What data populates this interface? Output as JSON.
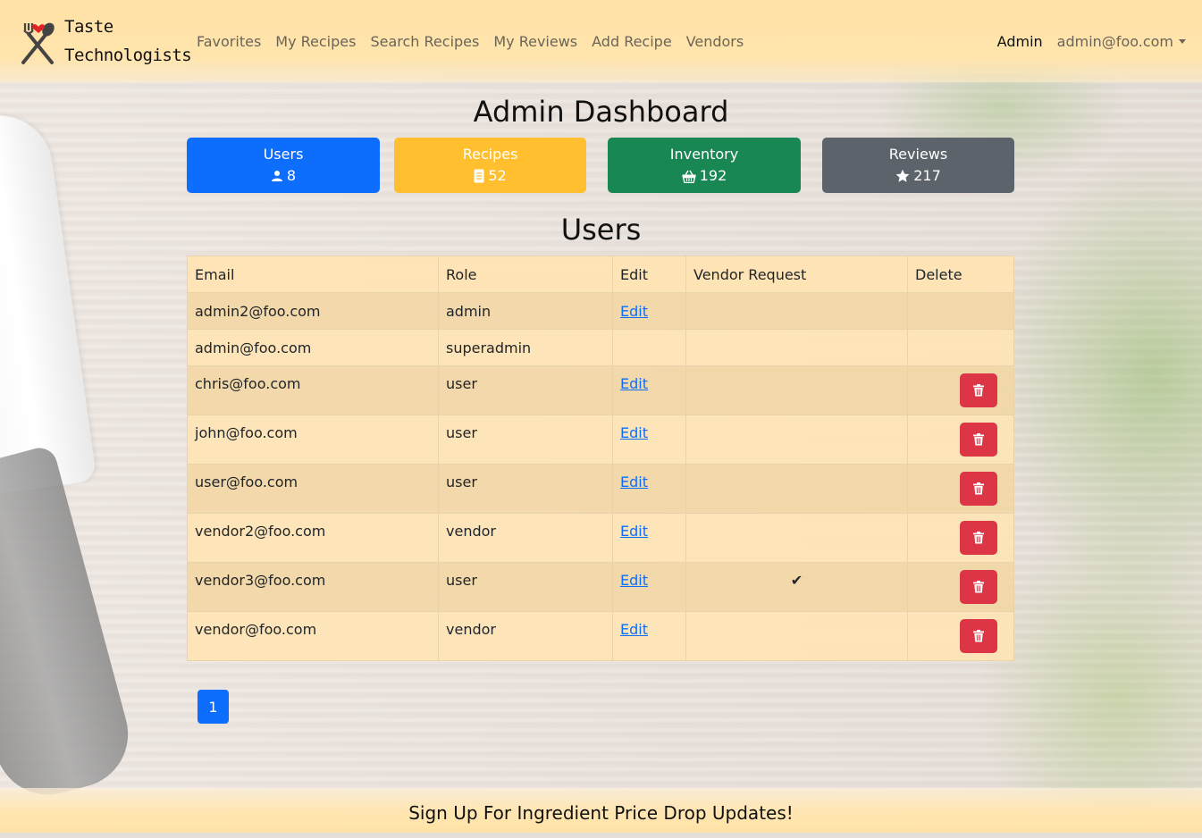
{
  "brand": {
    "line1": "Taste",
    "line2": "Technologists"
  },
  "nav": {
    "links": [
      "Favorites",
      "My Recipes",
      "Search Recipes",
      "My Reviews",
      "Add Recipe",
      "Vendors"
    ],
    "admin_label": "Admin",
    "user_email": "admin@foo.com"
  },
  "dashboard": {
    "title": "Admin Dashboard",
    "cards": [
      {
        "label": "Users",
        "value": "8",
        "icon": "user-icon",
        "color": "#0d6efd"
      },
      {
        "label": "Recipes",
        "value": "52",
        "icon": "document-icon",
        "color": "#ffbf2f"
      },
      {
        "label": "Inventory",
        "value": "192",
        "icon": "basket-icon",
        "color": "#198754"
      },
      {
        "label": "Reviews",
        "value": "217",
        "icon": "star-icon",
        "color": "#5c636a"
      }
    ]
  },
  "users_section": {
    "title": "Users",
    "headers": [
      "Email",
      "Role",
      "Edit",
      "Vendor Request",
      "Delete"
    ],
    "rows": [
      {
        "email": "admin2@foo.com",
        "role": "admin",
        "edit": "Edit",
        "vendor_request": "",
        "deletable": false
      },
      {
        "email": "admin@foo.com",
        "role": "superadmin",
        "edit": "",
        "vendor_request": "",
        "deletable": false
      },
      {
        "email": "chris@foo.com",
        "role": "user",
        "edit": "Edit",
        "vendor_request": "",
        "deletable": true
      },
      {
        "email": "john@foo.com",
        "role": "user",
        "edit": "Edit",
        "vendor_request": "",
        "deletable": true
      },
      {
        "email": "user@foo.com",
        "role": "user",
        "edit": "Edit",
        "vendor_request": "",
        "deletable": true
      },
      {
        "email": "vendor2@foo.com",
        "role": "vendor",
        "edit": "Edit",
        "vendor_request": "",
        "deletable": true
      },
      {
        "email": "vendor3@foo.com",
        "role": "user",
        "edit": "Edit",
        "vendor_request": "✔",
        "deletable": true
      },
      {
        "email": "vendor@foo.com",
        "role": "vendor",
        "edit": "Edit",
        "vendor_request": "",
        "deletable": true
      }
    ],
    "delete_icon": "trash-icon",
    "delete_color": "#dc3545"
  },
  "pagination": {
    "current_page": "1"
  },
  "footer": {
    "text": "Sign Up For Ingredient Price Drop Updates!"
  }
}
